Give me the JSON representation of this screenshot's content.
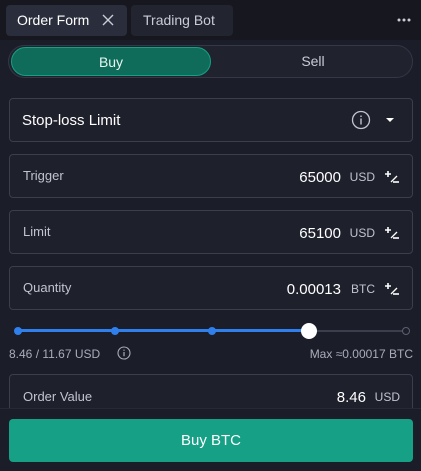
{
  "tabs": [
    {
      "label": "Order Form"
    },
    {
      "label": "Trading Bot"
    }
  ],
  "side": {
    "buy": "Buy",
    "sell": "Sell",
    "selected": "Buy"
  },
  "order_type": {
    "selected": "Stop-loss Limit"
  },
  "trigger": {
    "label": "Trigger",
    "value": "65000",
    "unit": "USD"
  },
  "limit": {
    "label": "Limit",
    "value": "65100",
    "unit": "USD"
  },
  "quantity": {
    "label": "Quantity",
    "value": "0.00013",
    "unit": "BTC"
  },
  "slider": {
    "level_fraction": 0.75,
    "steps": 5
  },
  "balance": {
    "available": "8.46 / 11.67 USD",
    "max": "Max ≈0.00017 BTC"
  },
  "order_value": {
    "label": "Order Value",
    "value": "8.46",
    "unit": "USD"
  },
  "submit": {
    "label": "Buy BTC"
  },
  "colors": {
    "accent": "#16a085",
    "slider": "#2f80ed",
    "background": "#1b1d29"
  },
  "icons": [
    "close-icon",
    "more-icon",
    "info-icon",
    "chevron-down-icon",
    "plus-minus-icon"
  ]
}
